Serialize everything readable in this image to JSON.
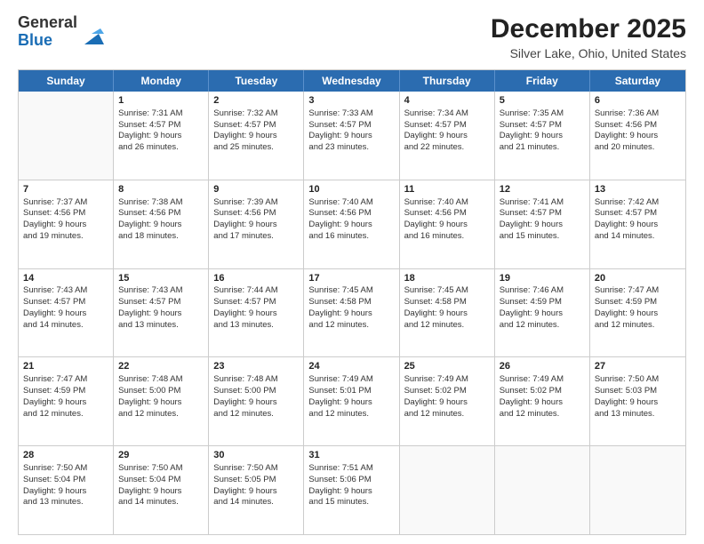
{
  "header": {
    "logo_general": "General",
    "logo_blue": "Blue",
    "title": "December 2025",
    "subtitle": "Silver Lake, Ohio, United States"
  },
  "days_of_week": [
    "Sunday",
    "Monday",
    "Tuesday",
    "Wednesday",
    "Thursday",
    "Friday",
    "Saturday"
  ],
  "weeks": [
    [
      {
        "day": "",
        "sunrise": "",
        "sunset": "",
        "daylight": "",
        "empty": true
      },
      {
        "day": "1",
        "sunrise": "Sunrise: 7:31 AM",
        "sunset": "Sunset: 4:57 PM",
        "daylight": "Daylight: 9 hours and 26 minutes.",
        "empty": false
      },
      {
        "day": "2",
        "sunrise": "Sunrise: 7:32 AM",
        "sunset": "Sunset: 4:57 PM",
        "daylight": "Daylight: 9 hours and 25 minutes.",
        "empty": false
      },
      {
        "day": "3",
        "sunrise": "Sunrise: 7:33 AM",
        "sunset": "Sunset: 4:57 PM",
        "daylight": "Daylight: 9 hours and 23 minutes.",
        "empty": false
      },
      {
        "day": "4",
        "sunrise": "Sunrise: 7:34 AM",
        "sunset": "Sunset: 4:57 PM",
        "daylight": "Daylight: 9 hours and 22 minutes.",
        "empty": false
      },
      {
        "day": "5",
        "sunrise": "Sunrise: 7:35 AM",
        "sunset": "Sunset: 4:57 PM",
        "daylight": "Daylight: 9 hours and 21 minutes.",
        "empty": false
      },
      {
        "day": "6",
        "sunrise": "Sunrise: 7:36 AM",
        "sunset": "Sunset: 4:56 PM",
        "daylight": "Daylight: 9 hours and 20 minutes.",
        "empty": false
      }
    ],
    [
      {
        "day": "7",
        "sunrise": "Sunrise: 7:37 AM",
        "sunset": "Sunset: 4:56 PM",
        "daylight": "Daylight: 9 hours and 19 minutes.",
        "empty": false
      },
      {
        "day": "8",
        "sunrise": "Sunrise: 7:38 AM",
        "sunset": "Sunset: 4:56 PM",
        "daylight": "Daylight: 9 hours and 18 minutes.",
        "empty": false
      },
      {
        "day": "9",
        "sunrise": "Sunrise: 7:39 AM",
        "sunset": "Sunset: 4:56 PM",
        "daylight": "Daylight: 9 hours and 17 minutes.",
        "empty": false
      },
      {
        "day": "10",
        "sunrise": "Sunrise: 7:40 AM",
        "sunset": "Sunset: 4:56 PM",
        "daylight": "Daylight: 9 hours and 16 minutes.",
        "empty": false
      },
      {
        "day": "11",
        "sunrise": "Sunrise: 7:40 AM",
        "sunset": "Sunset: 4:56 PM",
        "daylight": "Daylight: 9 hours and 16 minutes.",
        "empty": false
      },
      {
        "day": "12",
        "sunrise": "Sunrise: 7:41 AM",
        "sunset": "Sunset: 4:57 PM",
        "daylight": "Daylight: 9 hours and 15 minutes.",
        "empty": false
      },
      {
        "day": "13",
        "sunrise": "Sunrise: 7:42 AM",
        "sunset": "Sunset: 4:57 PM",
        "daylight": "Daylight: 9 hours and 14 minutes.",
        "empty": false
      }
    ],
    [
      {
        "day": "14",
        "sunrise": "Sunrise: 7:43 AM",
        "sunset": "Sunset: 4:57 PM",
        "daylight": "Daylight: 9 hours and 14 minutes.",
        "empty": false
      },
      {
        "day": "15",
        "sunrise": "Sunrise: 7:43 AM",
        "sunset": "Sunset: 4:57 PM",
        "daylight": "Daylight: 9 hours and 13 minutes.",
        "empty": false
      },
      {
        "day": "16",
        "sunrise": "Sunrise: 7:44 AM",
        "sunset": "Sunset: 4:57 PM",
        "daylight": "Daylight: 9 hours and 13 minutes.",
        "empty": false
      },
      {
        "day": "17",
        "sunrise": "Sunrise: 7:45 AM",
        "sunset": "Sunset: 4:58 PM",
        "daylight": "Daylight: 9 hours and 12 minutes.",
        "empty": false
      },
      {
        "day": "18",
        "sunrise": "Sunrise: 7:45 AM",
        "sunset": "Sunset: 4:58 PM",
        "daylight": "Daylight: 9 hours and 12 minutes.",
        "empty": false
      },
      {
        "day": "19",
        "sunrise": "Sunrise: 7:46 AM",
        "sunset": "Sunset: 4:59 PM",
        "daylight": "Daylight: 9 hours and 12 minutes.",
        "empty": false
      },
      {
        "day": "20",
        "sunrise": "Sunrise: 7:47 AM",
        "sunset": "Sunset: 4:59 PM",
        "daylight": "Daylight: 9 hours and 12 minutes.",
        "empty": false
      }
    ],
    [
      {
        "day": "21",
        "sunrise": "Sunrise: 7:47 AM",
        "sunset": "Sunset: 4:59 PM",
        "daylight": "Daylight: 9 hours and 12 minutes.",
        "empty": false
      },
      {
        "day": "22",
        "sunrise": "Sunrise: 7:48 AM",
        "sunset": "Sunset: 5:00 PM",
        "daylight": "Daylight: 9 hours and 12 minutes.",
        "empty": false
      },
      {
        "day": "23",
        "sunrise": "Sunrise: 7:48 AM",
        "sunset": "Sunset: 5:00 PM",
        "daylight": "Daylight: 9 hours and 12 minutes.",
        "empty": false
      },
      {
        "day": "24",
        "sunrise": "Sunrise: 7:49 AM",
        "sunset": "Sunset: 5:01 PM",
        "daylight": "Daylight: 9 hours and 12 minutes.",
        "empty": false
      },
      {
        "day": "25",
        "sunrise": "Sunrise: 7:49 AM",
        "sunset": "Sunset: 5:02 PM",
        "daylight": "Daylight: 9 hours and 12 minutes.",
        "empty": false
      },
      {
        "day": "26",
        "sunrise": "Sunrise: 7:49 AM",
        "sunset": "Sunset: 5:02 PM",
        "daylight": "Daylight: 9 hours and 12 minutes.",
        "empty": false
      },
      {
        "day": "27",
        "sunrise": "Sunrise: 7:50 AM",
        "sunset": "Sunset: 5:03 PM",
        "daylight": "Daylight: 9 hours and 13 minutes.",
        "empty": false
      }
    ],
    [
      {
        "day": "28",
        "sunrise": "Sunrise: 7:50 AM",
        "sunset": "Sunset: 5:04 PM",
        "daylight": "Daylight: 9 hours and 13 minutes.",
        "empty": false
      },
      {
        "day": "29",
        "sunrise": "Sunrise: 7:50 AM",
        "sunset": "Sunset: 5:04 PM",
        "daylight": "Daylight: 9 hours and 14 minutes.",
        "empty": false
      },
      {
        "day": "30",
        "sunrise": "Sunrise: 7:50 AM",
        "sunset": "Sunset: 5:05 PM",
        "daylight": "Daylight: 9 hours and 14 minutes.",
        "empty": false
      },
      {
        "day": "31",
        "sunrise": "Sunrise: 7:51 AM",
        "sunset": "Sunset: 5:06 PM",
        "daylight": "Daylight: 9 hours and 15 minutes.",
        "empty": false
      },
      {
        "day": "",
        "sunrise": "",
        "sunset": "",
        "daylight": "",
        "empty": true
      },
      {
        "day": "",
        "sunrise": "",
        "sunset": "",
        "daylight": "",
        "empty": true
      },
      {
        "day": "",
        "sunrise": "",
        "sunset": "",
        "daylight": "",
        "empty": true
      }
    ]
  ]
}
